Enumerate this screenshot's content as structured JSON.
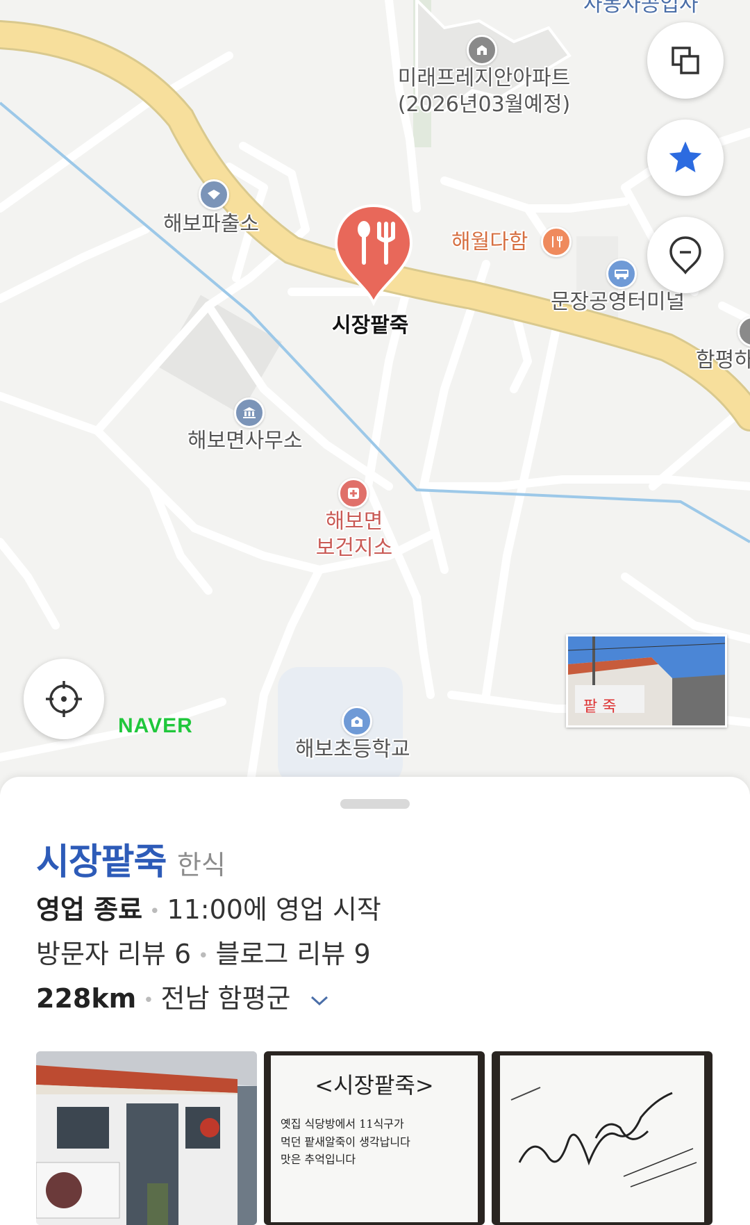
{
  "map": {
    "pois": {
      "apartment": "미래프레지안아파트\n(2026년03월예정)",
      "top_cut": "사동사공업사",
      "police": "해보파출소",
      "restaurant_other": "해월다함",
      "terminal": "문장공영터미널",
      "cut_right": "함평하",
      "selected": "시장팥죽",
      "office": "해보면사무소",
      "health": "해보면\n보건지소",
      "school": "해보초등학교"
    },
    "logo": "NAVER",
    "buttons": {
      "layers_icon": "layers-icon",
      "favorites_icon": "star-icon",
      "place_icon": "pin-icon",
      "locate_icon": "locate-icon"
    },
    "colors": {
      "main_road": "#f7df9c",
      "water": "#9cc8e8",
      "marker": "#e8685a",
      "star": "#2c6be0",
      "naver": "#20c73c"
    }
  },
  "place": {
    "name": "시장팥죽",
    "category": "한식",
    "status": "영업 종료",
    "hours_note": "11:00에 영업 시작",
    "visitor_reviews": "방문자 리뷰 6",
    "blog_reviews": "블로그 리뷰 9",
    "distance": "228km",
    "region": "전남 함평군"
  },
  "photos": {
    "handwritten_title": "<시장팥죽>",
    "handwritten_lines": [
      "옛집 식당방에서 11식구가",
      "먹던 팥새알죽이 생각납니다",
      "맛은 추억입니다"
    ]
  }
}
